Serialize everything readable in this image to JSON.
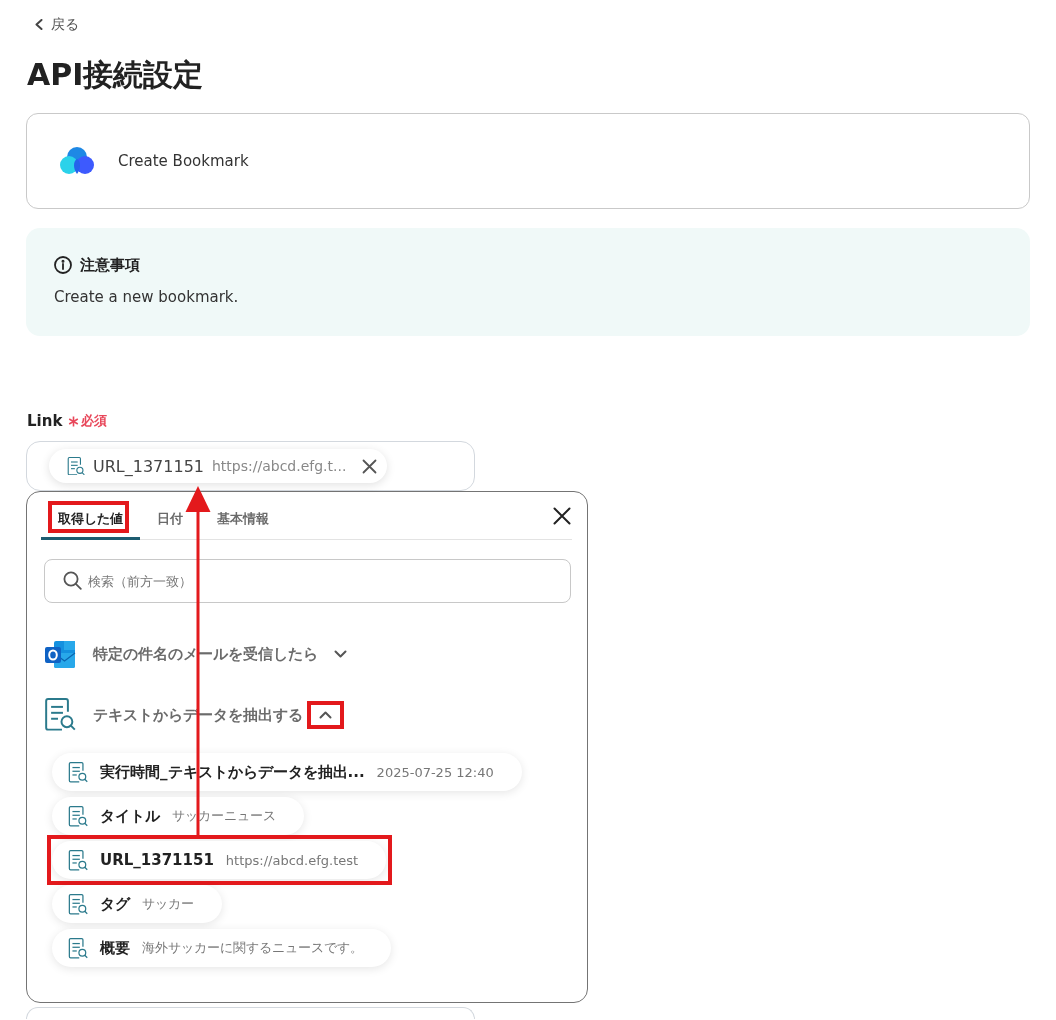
{
  "back_link": {
    "label": "戻る"
  },
  "title": "API接続設定",
  "action_card": {
    "name": "Create Bookmark"
  },
  "notice": {
    "heading": "注意事項",
    "body": "Create a new bookmark."
  },
  "link_field": {
    "label": "Link",
    "required": true,
    "required_label": "必須",
    "chip": {
      "name": "URL_1371151",
      "value": "https://abcd.efg.t..."
    }
  },
  "picker": {
    "tabs": [
      {
        "label": "取得した値",
        "selected": true,
        "highlighted": true
      },
      {
        "label": "日付",
        "selected": false,
        "highlighted": false
      },
      {
        "label": "基本情報",
        "selected": false,
        "highlighted": false
      }
    ],
    "search": {
      "placeholder": "検索（前方一致）"
    },
    "groups": [
      {
        "kind": "mail-app",
        "title": "特定の件名のメールを受信したら",
        "expanded": false,
        "toggle_highlighted": false
      },
      {
        "kind": "text-extract",
        "title": "テキストからデータを抽出する",
        "expanded": true,
        "toggle_highlighted": true,
        "children": [
          {
            "name": "実行時間_テキストからデータを抽出...",
            "value": "2025-07-25 12:40",
            "highlighted": false
          },
          {
            "name": "タイトル",
            "value": "サッカーニュース",
            "highlighted": false
          },
          {
            "name": "URL_1371151",
            "value": "https://abcd.efg.test",
            "highlighted": true
          },
          {
            "name": "タグ",
            "value": "サッカー",
            "highlighted": false
          },
          {
            "name": "概要",
            "value": "海外サッカーに関するニュースです。",
            "highlighted": false
          }
        ]
      }
    ]
  },
  "annotation_arrow": true,
  "next_field": {
    "shown": true
  }
}
